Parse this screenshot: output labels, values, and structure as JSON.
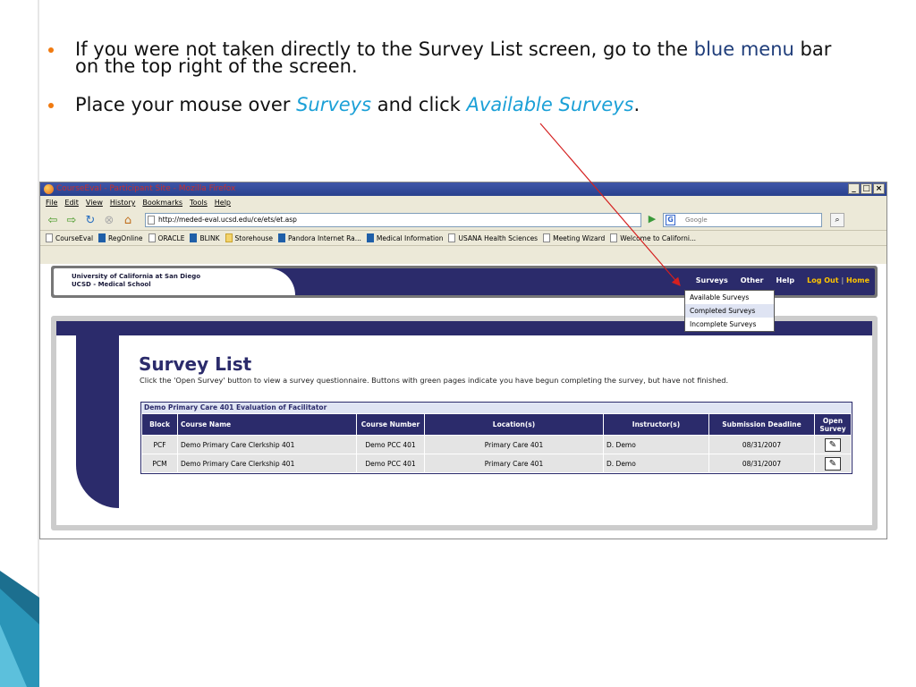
{
  "slide": {
    "bullet1": {
      "text_before": "If you were not taken directly to the Survey List screen, go to the ",
      "highlight": "blue menu",
      "text_after": " bar on the top right of the screen."
    },
    "bullet2": {
      "text_before": "Place your mouse over ",
      "em1": "Surveys",
      "text_mid": " and click ",
      "em2": "Available Surveys",
      "text_after": "."
    },
    "colors": {
      "bullet": "#f07a10",
      "emphasis": "#1ba0d7",
      "highlight": "#1f3d7a",
      "arrow": "#d42020"
    }
  },
  "browser": {
    "title": "CourseEval - Participant Site - Mozilla Firefox",
    "window_buttons": [
      "_",
      "□",
      "×"
    ],
    "menu": [
      "File",
      "Edit",
      "View",
      "History",
      "Bookmarks",
      "Tools",
      "Help"
    ],
    "url": "http://meded-eval.ucsd.edu/ce/ets/et.asp",
    "search_placeholder": "Google",
    "bookmarks": [
      "CourseEval",
      "RegOnline",
      "ORACLE",
      "BLINK",
      "Storehouse",
      "Pandora Internet Ra...",
      "Medical Information",
      "USANA Health Sciences",
      "Meeting Wizard",
      "Welcome to Californi..."
    ]
  },
  "site": {
    "org_line1": "University of California at San Diego",
    "org_line2": "UCSD - Medical School",
    "nav": {
      "surveys": "Surveys",
      "other": "Other",
      "help": "Help",
      "logout": "Log Out",
      "sep": "|",
      "home": "Home"
    },
    "dropdown": [
      "Available Surveys",
      "Completed Surveys",
      "Incomplete Surveys"
    ]
  },
  "main": {
    "title": "Survey List",
    "description": "Click the 'Open Survey' button to view a survey questionnaire. Buttons with green pages indicate you have begun completing the survey, but have not finished.",
    "table_caption": "Demo Primary Care 401 Evaluation of Facilitator",
    "headers": [
      "Block",
      "Course Name",
      "Course Number",
      "Location(s)",
      "Instructor(s)",
      "Submission Deadline",
      "Open Survey"
    ],
    "rows": [
      {
        "block": "PCF",
        "course_name": "Demo Primary Care Clerkship 401",
        "course_number": "Demo PCC 401",
        "location": "Primary Care 401",
        "instructor": "D. Demo",
        "deadline": "08/31/2007"
      },
      {
        "block": "PCM",
        "course_name": "Demo Primary Care Clerkship 401",
        "course_number": "Demo PCC 401",
        "location": "Primary Care 401",
        "instructor": "D. Demo",
        "deadline": "08/31/2007"
      }
    ]
  }
}
